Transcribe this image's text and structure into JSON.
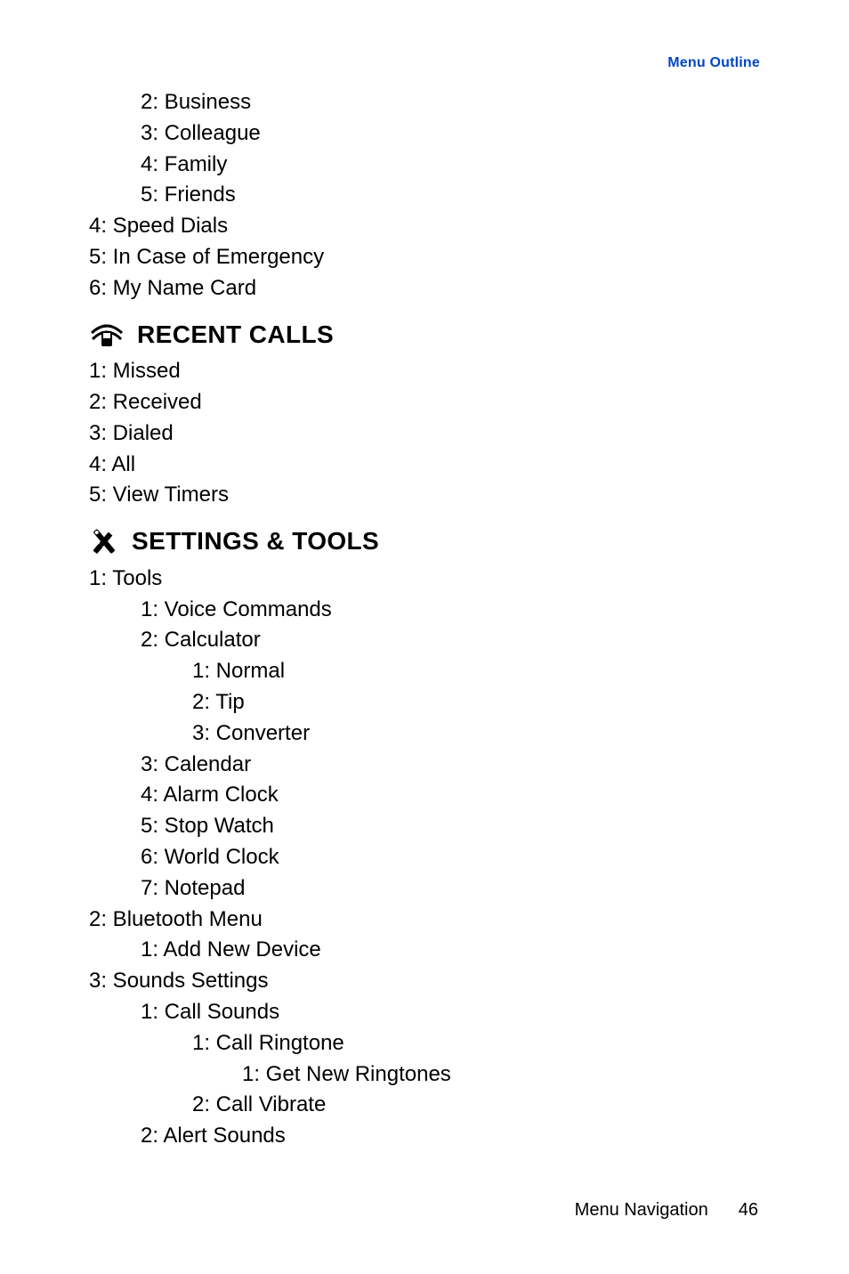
{
  "header": {
    "right_label": "Menu Outline"
  },
  "pre_items": [
    {
      "lvl": 1,
      "text": "2: Business"
    },
    {
      "lvl": 1,
      "text": "3: Colleague"
    },
    {
      "lvl": 1,
      "text": "4: Family"
    },
    {
      "lvl": 1,
      "text": "5: Friends"
    },
    {
      "lvl": 0,
      "text": "4: Speed Dials"
    },
    {
      "lvl": 0,
      "text": "5: In Case of Emergency"
    },
    {
      "lvl": 0,
      "text": "6: My Name Card"
    }
  ],
  "sections": [
    {
      "icon": "recent-calls-icon",
      "title": "RECENT CALLS",
      "items": [
        {
          "lvl": 0,
          "text": "1: Missed"
        },
        {
          "lvl": 0,
          "text": "2: Received"
        },
        {
          "lvl": 0,
          "text": "3: Dialed"
        },
        {
          "lvl": 0,
          "text": "4: All"
        },
        {
          "lvl": 0,
          "text": "5: View Timers"
        }
      ]
    },
    {
      "icon": "settings-tools-icon",
      "title": "SETTINGS & TOOLS",
      "items": [
        {
          "lvl": 0,
          "text": "1: Tools"
        },
        {
          "lvl": 1,
          "text": "1: Voice Commands"
        },
        {
          "lvl": 1,
          "text": "2: Calculator"
        },
        {
          "lvl": 2,
          "text": "1: Normal"
        },
        {
          "lvl": 2,
          "text": "2: Tip"
        },
        {
          "lvl": 2,
          "text": "3: Converter"
        },
        {
          "lvl": 1,
          "text": "3: Calendar"
        },
        {
          "lvl": 1,
          "text": "4: Alarm Clock"
        },
        {
          "lvl": 1,
          "text": "5: Stop Watch"
        },
        {
          "lvl": 1,
          "text": "6: World Clock"
        },
        {
          "lvl": 1,
          "text": "7: Notepad"
        },
        {
          "lvl": 0,
          "text": "2: Bluetooth Menu"
        },
        {
          "lvl": 1,
          "text": "1: Add New Device"
        },
        {
          "lvl": 0,
          "text": "3: Sounds Settings"
        },
        {
          "lvl": 1,
          "text": "1: Call Sounds"
        },
        {
          "lvl": 2,
          "text": "1: Call Ringtone"
        },
        {
          "lvl": 3,
          "text": "1: Get New Ringtones"
        },
        {
          "lvl": 2,
          "text": "2: Call Vibrate"
        },
        {
          "lvl": 1,
          "text": "2: Alert Sounds"
        }
      ]
    }
  ],
  "footer": {
    "section": "Menu Navigation",
    "page": "46"
  }
}
